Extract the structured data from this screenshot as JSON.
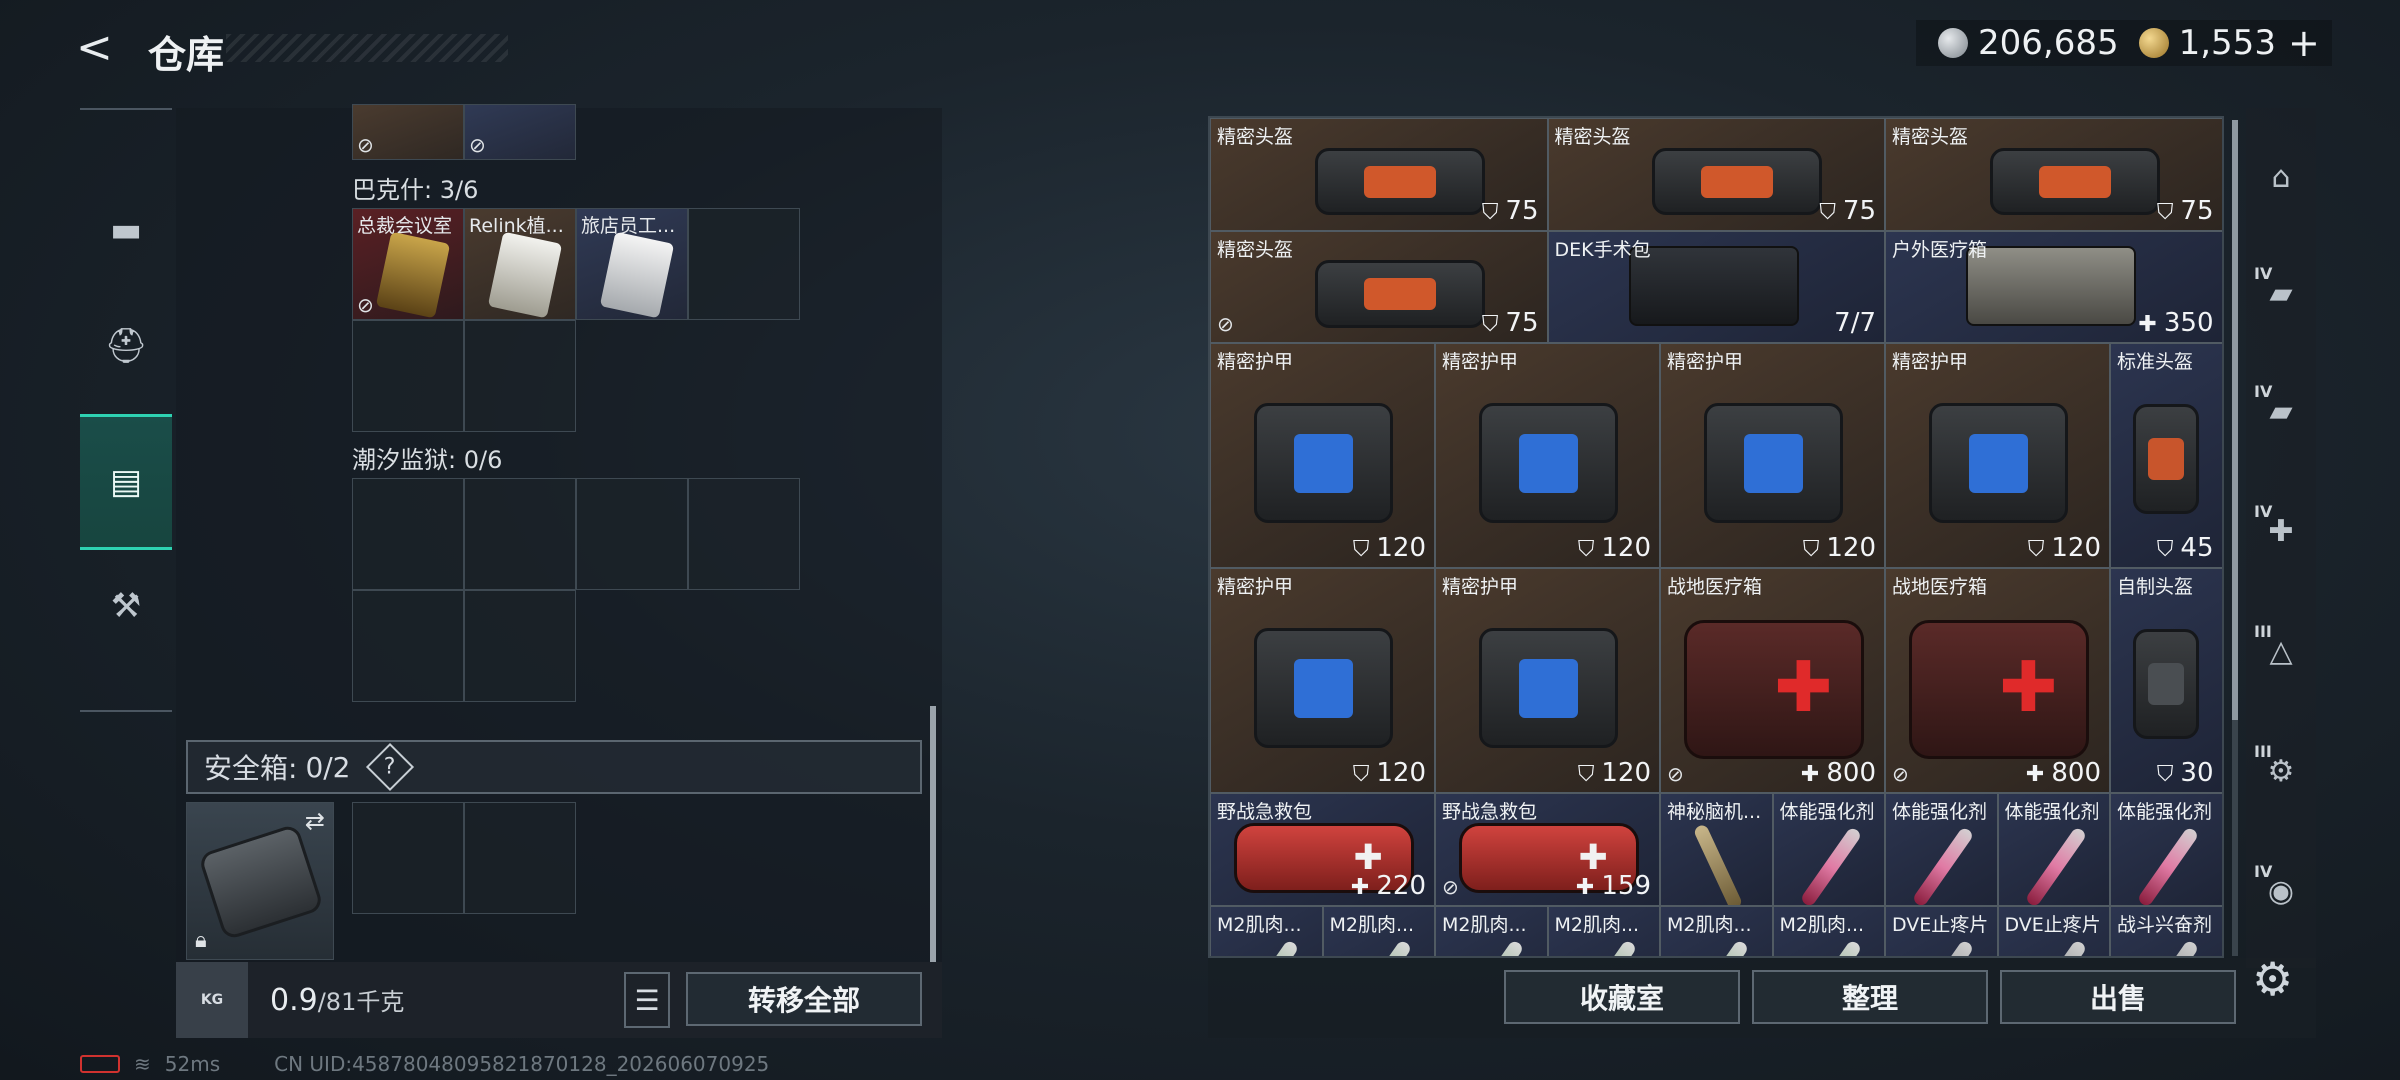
{
  "header": {
    "back_glyph": "<",
    "title": "仓库",
    "silver": "206,685",
    "gold": "1,553",
    "plus": "+"
  },
  "left_rail": [
    {
      "icon": "gun-icon",
      "glyph": "▬"
    },
    {
      "icon": "backpack-icon",
      "glyph": "⛑"
    },
    {
      "icon": "container-icon",
      "glyph": "▤",
      "active": true
    },
    {
      "icon": "toolbox-icon",
      "glyph": "⚒"
    }
  ],
  "left_panel": {
    "bakeshi_label": "巴克什: 3/6",
    "keys": [
      {
        "name": "总裁会议室",
        "tint": "red"
      },
      {
        "name": "Relink植...",
        "tint": "brown"
      },
      {
        "name": "旅店员工...",
        "tint": "blue"
      }
    ],
    "chaoxi_label": "潮汐监狱: 0/6",
    "safe_label": "安全箱:",
    "safe_count": "0/2",
    "safe_help": "?",
    "weight_value": "0.9",
    "weight_limit": "/81千克",
    "kg_badge": "KG",
    "transfer_all": "转移全部"
  },
  "right_grid": {
    "items": [
      {
        "name": "精密头盔",
        "value": "75",
        "type": "helmet"
      },
      {
        "name": "精密头盔",
        "value": "75",
        "type": "helmet"
      },
      {
        "name": "精密头盔",
        "value": "75",
        "type": "helmet"
      },
      {
        "name": "精密头盔",
        "value": "75",
        "type": "helmet"
      },
      {
        "name": "DEK手术包",
        "value": "7/7",
        "type": "surgery"
      },
      {
        "name": "户外医疗箱",
        "value": "350",
        "type": "outdoor-kit"
      },
      {
        "name": "精密护甲",
        "value": "120",
        "type": "armor"
      },
      {
        "name": "精密护甲",
        "value": "120",
        "type": "armor"
      },
      {
        "name": "精密护甲",
        "value": "120",
        "type": "armor"
      },
      {
        "name": "精密护甲",
        "value": "120",
        "type": "armor"
      },
      {
        "name": "标准头盔",
        "value": "45",
        "type": "helmet-std"
      },
      {
        "name": "精密护甲",
        "value": "120",
        "type": "armor"
      },
      {
        "name": "精密护甲",
        "value": "120",
        "type": "armor"
      },
      {
        "name": "战地医疗箱",
        "value": "800",
        "type": "medkit"
      },
      {
        "name": "战地医疗箱",
        "value": "800",
        "type": "medkit"
      },
      {
        "name": "自制头盔",
        "value": "30",
        "type": "helmet-diy"
      },
      {
        "name": "野战急救包",
        "value": "220",
        "type": "firstaid"
      },
      {
        "name": "野战急救包",
        "value": "159",
        "type": "firstaid"
      },
      {
        "name": "神秘脑机...",
        "value": "",
        "type": "brain"
      },
      {
        "name": "体能强化剂",
        "value": "",
        "type": "stim"
      },
      {
        "name": "体能强化剂",
        "value": "",
        "type": "stim"
      },
      {
        "name": "体能强化剂",
        "value": "",
        "type": "stim"
      },
      {
        "name": "体能强化剂",
        "value": "",
        "type": "stim"
      },
      {
        "name": "M2肌肉...",
        "value": "",
        "type": "m2"
      },
      {
        "name": "M2肌肉...",
        "value": "",
        "type": "m2"
      },
      {
        "name": "M2肌肉...",
        "value": "",
        "type": "m2"
      },
      {
        "name": "M2肌肉...",
        "value": "",
        "type": "m2"
      },
      {
        "name": "M2肌肉...",
        "value": "",
        "type": "m2"
      },
      {
        "name": "M2肌肉...",
        "value": "",
        "type": "m2"
      },
      {
        "name": "DVE止疼片",
        "value": "",
        "type": "pill"
      },
      {
        "name": "DVE止疼片",
        "value": "",
        "type": "pill"
      },
      {
        "name": "战斗兴奋剂",
        "value": "",
        "type": "pill"
      }
    ]
  },
  "actions": {
    "collection": "收藏室",
    "sort": "整理",
    "sell": "出售"
  },
  "right_rail": [
    {
      "icon": "safe-room-icon",
      "tier": "",
      "glyph": "⌂"
    },
    {
      "icon": "folder-tier4-icon",
      "tier": "IV",
      "glyph": "▰"
    },
    {
      "icon": "folder-tier4b-icon",
      "tier": "IV",
      "glyph": "▰"
    },
    {
      "icon": "medkit-tier4-icon",
      "tier": "IV",
      "glyph": "✚"
    },
    {
      "icon": "triangle-tier3-icon",
      "tier": "III",
      "glyph": "△"
    },
    {
      "icon": "gear-tier3-icon",
      "tier": "III",
      "glyph": "⚙"
    },
    {
      "icon": "eye-tier4-icon",
      "tier": "IV",
      "glyph": "◉"
    }
  ],
  "status": {
    "ping": "52ms",
    "uid": "CN UID:4587804809582187012​8_202606070925"
  },
  "colors": {
    "accent": "#2ed2b2",
    "brown_cell": "#4a3a2d",
    "blue_cell": "#2c3550"
  }
}
